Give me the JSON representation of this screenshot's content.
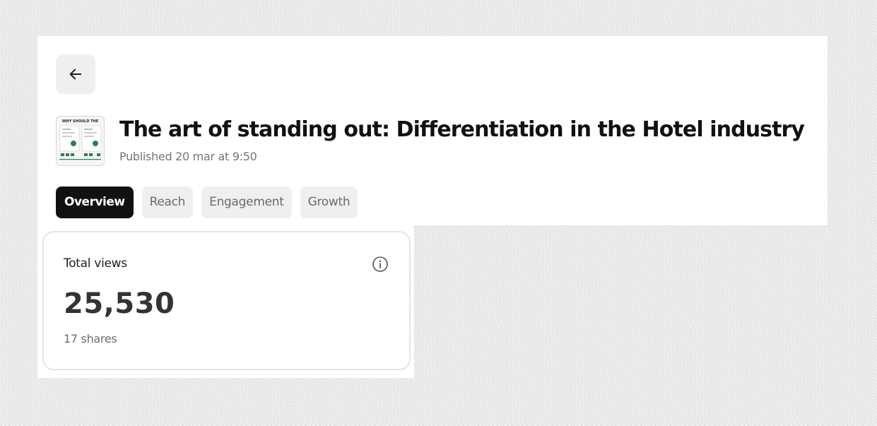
{
  "header": {
    "back_icon": "arrow-left-icon",
    "title": "The art of standing out: Differentiation in the Hotel industry",
    "published": "Published 20 mar at 9:50",
    "thumbnail_text": "WHY SHOULD THE"
  },
  "tabs": [
    {
      "label": "Overview",
      "active": true
    },
    {
      "label": "Reach",
      "active": false
    },
    {
      "label": "Engagement",
      "active": false
    },
    {
      "label": "Growth",
      "active": false
    }
  ],
  "stats": {
    "label": "Total views",
    "value": "25,530",
    "sub": "17 shares",
    "info_icon": "info-icon"
  },
  "colors": {
    "active_tab_bg": "#111111",
    "inactive_tab_bg": "#efefef",
    "accent_green": "#2e7d52"
  }
}
